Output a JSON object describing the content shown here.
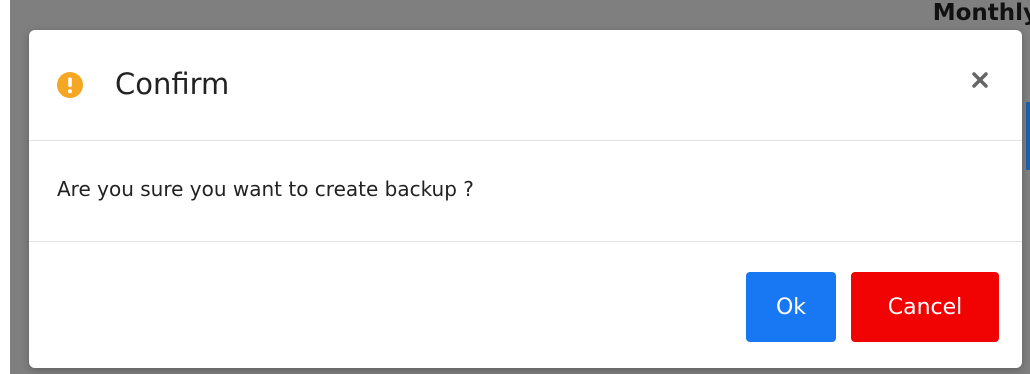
{
  "background": {
    "heading": "Monthly"
  },
  "dialog": {
    "title": "Confirm",
    "message": "Are you sure you want to create backup ?",
    "icon": "warning-icon",
    "close_icon": "close-icon",
    "ok_label": "Ok",
    "cancel_label": "Cancel"
  },
  "colors": {
    "warning": "#f5a623",
    "ok_button": "#1877f2",
    "cancel_button": "#f20303",
    "backdrop": "#7f7f7f"
  }
}
